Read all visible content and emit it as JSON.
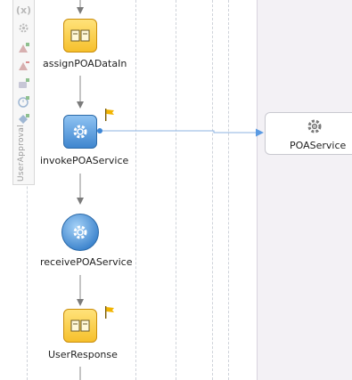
{
  "palette": {
    "icons": [
      "variable-icon",
      "settings-icon",
      "add-assign-icon",
      "remove-assign-icon",
      "add-rule-icon",
      "timer-icon",
      "add-flow-icon"
    ],
    "label": "UserApproval"
  },
  "activities": [
    {
      "label": "assignPOADataIn",
      "kind": "assign"
    },
    {
      "label": "invokePOAService",
      "kind": "invoke"
    },
    {
      "label": "receivePOAService",
      "kind": "receive"
    },
    {
      "label": "UserResponse",
      "kind": "assign"
    }
  ],
  "partner_link": {
    "label": "POAService"
  },
  "colors": {
    "assign_fill": "#f6c02c",
    "invoke_fill": "#3f86cf",
    "connector": "#7da6d8",
    "partner_lane": "#f3f1f5"
  }
}
